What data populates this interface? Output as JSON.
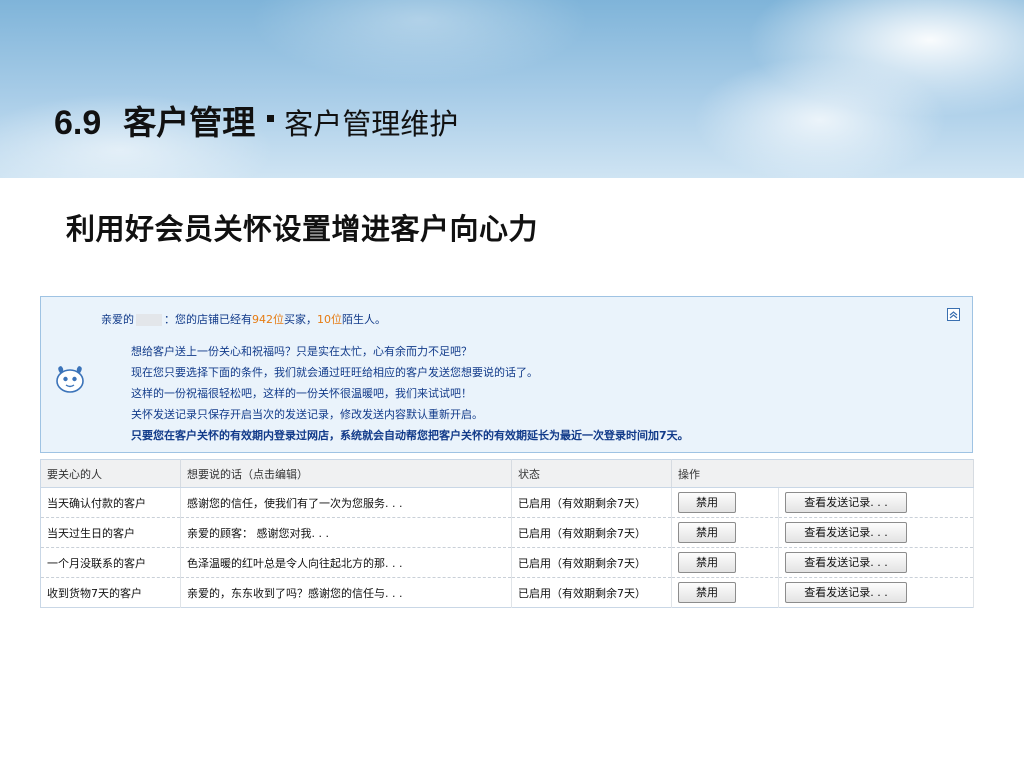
{
  "header": {
    "section_number": "6.9",
    "section_title": "客户管理",
    "section_subtitle": "客户管理维护"
  },
  "subtitle": "利用好会员关怀设置增进客户向心力",
  "panel": {
    "greeting_prefix": "亲爱的",
    "greeting_mid": "：您的店铺已经有",
    "buyers_count": "942位",
    "buyers_suffix": "买家，",
    "strangers_count": "10位",
    "strangers_suffix": "陌生人。",
    "lines": [
      "想给客户送上一份关心和祝福吗？只是实在太忙，心有余而力不足吧？",
      "现在您只要选择下面的条件，我们就会通过旺旺给相应的客户发送您想要说的话了。",
      "这样的一份祝福很轻松吧，这样的一份关怀很温暖吧，我们来试试吧！",
      "关怀发送记录只保存开启当次的发送记录，修改发送内容默认重新开启。"
    ],
    "bold_line": "只要您在客户关怀的有效期内登录过网店，系统就会自动帮您把客户关怀的有效期延长为最近一次登录时间加7天。"
  },
  "table": {
    "headers": [
      "要关心的人",
      "想要说的话（点击编辑）",
      "状态",
      "操作"
    ],
    "rows": [
      {
        "target": "当天确认付款的客户",
        "message": "感谢您的信任，使我们有了一次为您服务. . .",
        "status": "已启用（有效期剩余7天）",
        "ban": "禁用",
        "log": "查看发送记录. . ."
      },
      {
        "target": "当天过生日的客户",
        "message": "亲爱的顾客：  感谢您对我. . .",
        "status": "已启用（有效期剩余7天）",
        "ban": "禁用",
        "log": "查看发送记录. . ."
      },
      {
        "target": "一个月没联系的客户",
        "message": "色泽温暖的红叶总是令人向往起北方的那. . .",
        "status": "已启用（有效期剩余7天）",
        "ban": "禁用",
        "log": "查看发送记录. . ."
      },
      {
        "target": "收到货物7天的客户",
        "message": "亲爱的，东东收到了吗？感谢您的信任与. . .",
        "status": "已启用（有效期剩余7天）",
        "ban": "禁用",
        "log": "查看发送记录. . ."
      }
    ]
  },
  "icons": {
    "collapse": "collapse-up-icon",
    "mascot": "mascot-icon"
  },
  "colors": {
    "link_text": "#123b8a",
    "highlight": "#e67b12",
    "status_green": "#2a8a2a",
    "panel_bg": "#eaf3fb"
  }
}
